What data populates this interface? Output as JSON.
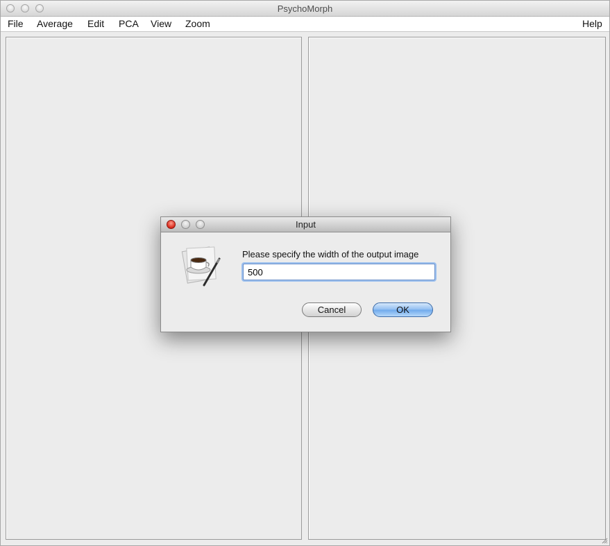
{
  "window": {
    "title": "PsychoMorph"
  },
  "menubar": {
    "items": [
      "File",
      "Average",
      "Edit",
      "PCA",
      "View",
      "Zoom"
    ],
    "help": "Help"
  },
  "dialog": {
    "title": "Input",
    "prompt": "Please specify the width of the output image",
    "input_value": "500",
    "cancel_label": "Cancel",
    "ok_label": "OK",
    "icon": "java-coffee-cup-icon"
  }
}
